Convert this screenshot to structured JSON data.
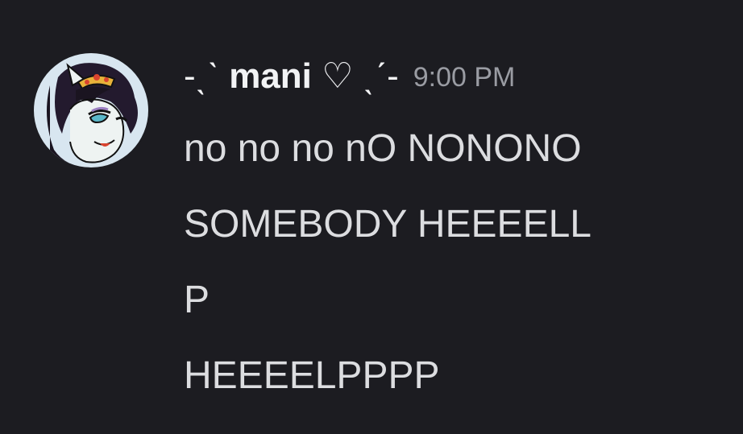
{
  "message": {
    "author": {
      "prefix": "-ˎˋ ",
      "name": "mani",
      "suffix": " ♡ ˎˊ-",
      "avatar_icon": "pony-avatar-icon"
    },
    "timestamp": "9:00 PM",
    "lines": [
      "no no no nO NONONO",
      "SOMEBODY HEEEELL",
      "P",
      "HEEEELPPPP"
    ]
  },
  "colors": {
    "background": "#1c1c21",
    "username": "#f2f3f5",
    "timestamp": "#9a9ca3",
    "text": "#dcdde0"
  }
}
